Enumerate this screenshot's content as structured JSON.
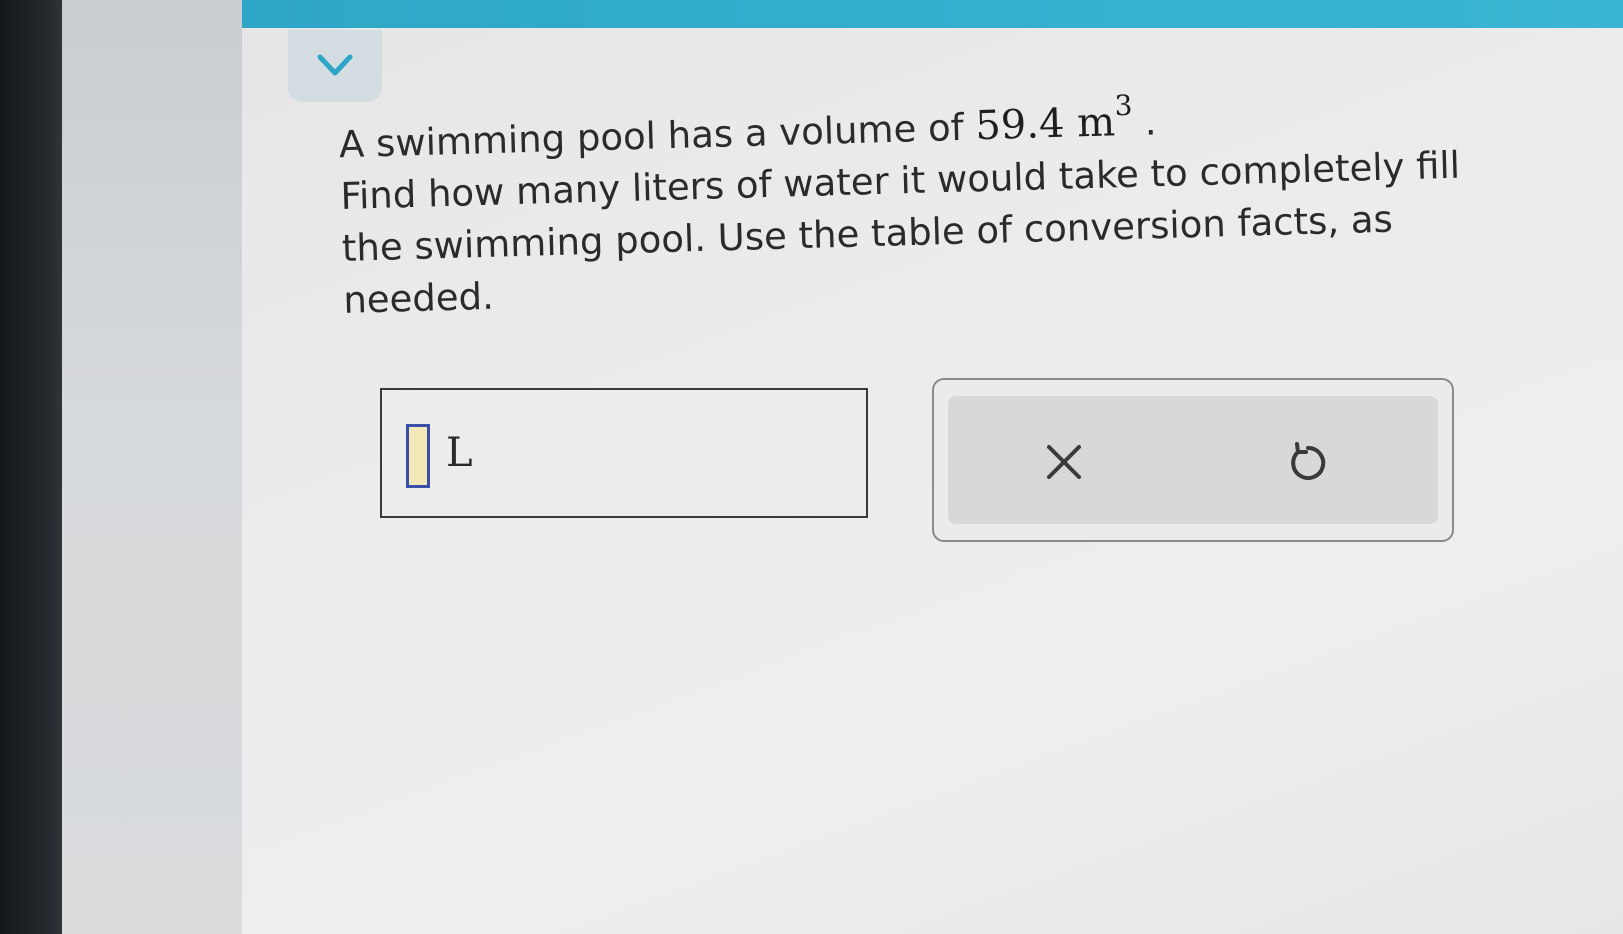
{
  "question": {
    "line1_prefix": "A swimming pool has a volume of ",
    "volume_value": "59.4",
    "volume_unit": "m",
    "volume_exponent": "3",
    "line1_suffix": ".",
    "body": "Find how many liters of water it would take to completely fill the swimming pool. Use the table of conversion facts, as needed."
  },
  "answer": {
    "unit": "L",
    "value": ""
  },
  "icons": {
    "collapse": "chevron-down-icon",
    "clear": "close-icon",
    "reset": "undo-icon"
  },
  "colors": {
    "top_bar": "#33b1cf",
    "chevron": "#2fa6c7",
    "input_border": "#3b4fa8",
    "input_fill": "#f2e9b6"
  }
}
